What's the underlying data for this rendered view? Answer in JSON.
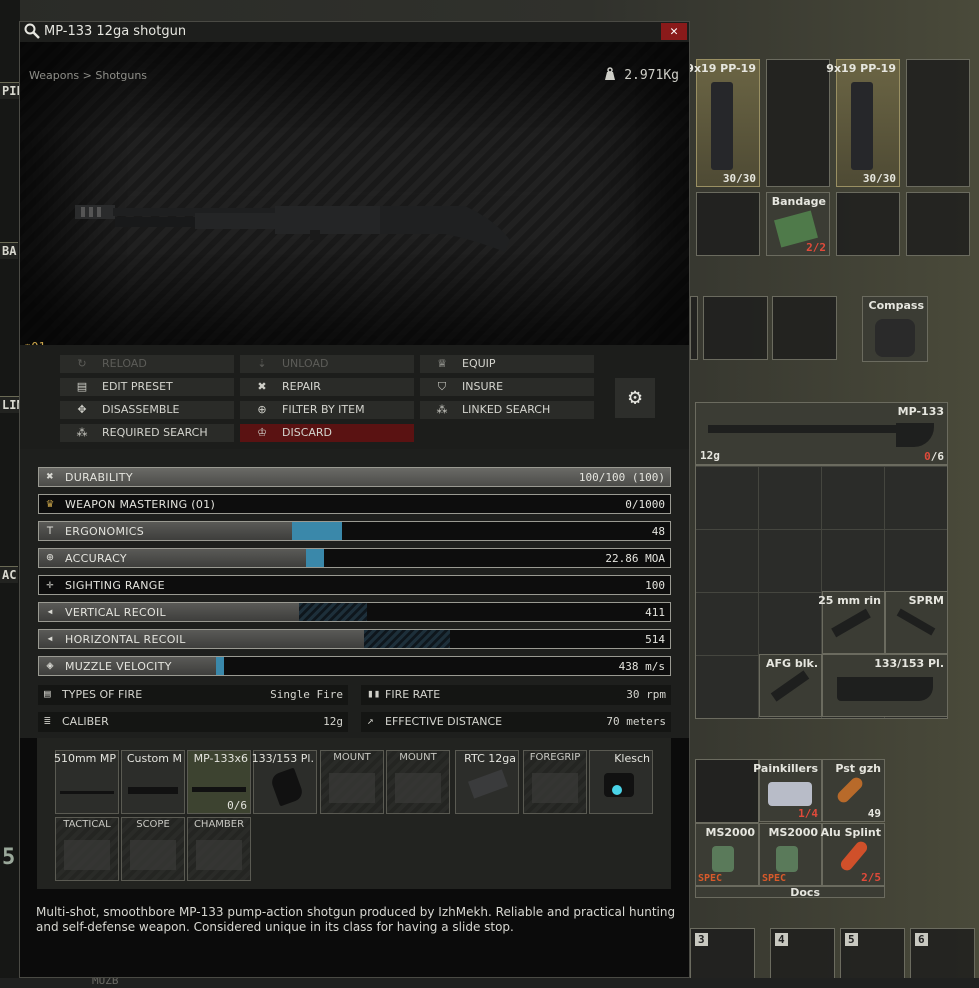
{
  "window": {
    "title": "MP-133 12ga shotgun",
    "close": "✕",
    "breadcrumb": "Weapons > Shotguns",
    "weight": "2.971Kg",
    "mastery_level": "01"
  },
  "actions": [
    {
      "label": "RELOAD",
      "icon": "reload-icon",
      "disabled": true
    },
    {
      "label": "UNLOAD",
      "icon": "unload-icon",
      "disabled": true
    },
    {
      "label": "EQUIP",
      "icon": "equip-icon",
      "disabled": false
    },
    {
      "label": "EDIT PRESET",
      "icon": "preset-icon",
      "disabled": false
    },
    {
      "label": "REPAIR",
      "icon": "wrench-icon",
      "disabled": false
    },
    {
      "label": "INSURE",
      "icon": "shield-icon",
      "disabled": false
    },
    {
      "label": "DISASSEMBLE",
      "icon": "disassemble-icon",
      "disabled": false
    },
    {
      "label": "FILTER BY ITEM",
      "icon": "magnifier-icon",
      "disabled": false
    },
    {
      "label": "LINKED SEARCH",
      "icon": "linked-search-icon",
      "disabled": false
    },
    {
      "label": "REQUIRED SEARCH",
      "icon": "required-search-icon",
      "disabled": false
    },
    {
      "label": "DISCARD",
      "icon": "discard-icon",
      "disabled": false
    }
  ],
  "stats": [
    {
      "label": "DURABILITY",
      "value": "100/100 (100)",
      "fill": 1.0,
      "icon": "wrench-icon"
    },
    {
      "label": "WEAPON MASTERING (01)",
      "value": "0/1000",
      "fill": 0.0,
      "icon": "mastery-icon"
    },
    {
      "label": "ERGONOMICS",
      "value": "48",
      "fill": 0.48,
      "icon": "ergonomics-icon"
    },
    {
      "label": "ACCURACY",
      "value": "22.86 MOA",
      "fill": 0.46,
      "icon": "crosshair-icon"
    },
    {
      "label": "SIGHTING RANGE",
      "value": "100",
      "fill": 0.0,
      "icon": "sight-icon"
    },
    {
      "label": "VERTICAL RECOIL",
      "value": "411",
      "fill": 0.41,
      "icon": "recoil-icon"
    },
    {
      "label": "HORIZONTAL RECOIL",
      "value": "514",
      "fill": 0.51,
      "icon": "recoil-icon"
    },
    {
      "label": "MUZZLE VELOCITY",
      "value": "438 m/s",
      "fill": 0.28,
      "icon": "velocity-icon"
    }
  ],
  "props": [
    {
      "label": "TYPES OF FIRE",
      "value": "Single Fire",
      "icon": "fire-type-icon"
    },
    {
      "label": "FIRE RATE",
      "value": "30 rpm",
      "icon": "fire-rate-icon"
    },
    {
      "label": "CALIBER",
      "value": "12g",
      "icon": "caliber-icon"
    },
    {
      "label": "EFFECTIVE DISTANCE",
      "value": "70 meters",
      "icon": "distance-icon"
    }
  ],
  "mods": [
    {
      "name": "510mm MP",
      "type": "barrel",
      "empty": false
    },
    {
      "name": "Custom M",
      "type": "forend",
      "empty": false
    },
    {
      "name": "MP-133x6",
      "type": "magazine",
      "empty": false,
      "count": "0/6"
    },
    {
      "name": "133/153 Pl.",
      "type": "grip",
      "empty": false
    },
    {
      "name": "MOUNT",
      "type": "mount",
      "empty": true
    },
    {
      "name": "MOUNT",
      "type": "mount",
      "empty": true
    },
    {
      "name": "RTC 12ga",
      "type": "muzzle",
      "empty": false
    },
    {
      "name": "FOREGRIP",
      "type": "foregrip",
      "empty": true
    },
    {
      "name": "Klesch",
      "type": "flashlight",
      "empty": false
    },
    {
      "name": "TACTICAL",
      "type": "tactical",
      "empty": true
    },
    {
      "name": "SCOPE",
      "type": "scope",
      "empty": true
    },
    {
      "name": "CHAMBER",
      "type": "chamber",
      "empty": true
    }
  ],
  "description": "Multi-shot, smoothbore MP-133 pump-action shotgun produced by IzhMekh. Reliable and practical hunting and self-defense weapon. Considered unique in its class for having a slide stop.",
  "inventory": {
    "mag1": {
      "name": "9x19 PP-19",
      "count": "30/30"
    },
    "mag2": {
      "name": "9x19 PP-19",
      "count": "30/30"
    },
    "bandage": {
      "name": "Bandage",
      "count": "2/2"
    },
    "compass": {
      "name": "Compass"
    },
    "weapon": {
      "name": "MP-133",
      "caliber": "12g",
      "ammo_loaded": "0",
      "ammo_capacity": "/6"
    },
    "rig": [
      {
        "name": "25 mm rin"
      },
      {
        "name": "SPRM"
      },
      {
        "name": "AFG blk."
      },
      {
        "name": "133/153 Pl."
      }
    ],
    "pocket": [
      {
        "name": "Painkillers",
        "count": "1/4"
      },
      {
        "name": "Pst gzh",
        "count": "49"
      },
      {
        "name": "MS2000",
        "badge": "SPEC"
      },
      {
        "name": "MS2000",
        "badge": "SPEC"
      },
      {
        "name": "Alu Splint",
        "count": "2/5"
      },
      {
        "name": "Docs"
      }
    ],
    "slots": [
      "3",
      "4",
      "5",
      "6"
    ]
  },
  "background": {
    "tags": [
      "PIE",
      "BA",
      "LIN",
      "AC",
      "5."
    ],
    "bottom_text": "MUZB"
  }
}
